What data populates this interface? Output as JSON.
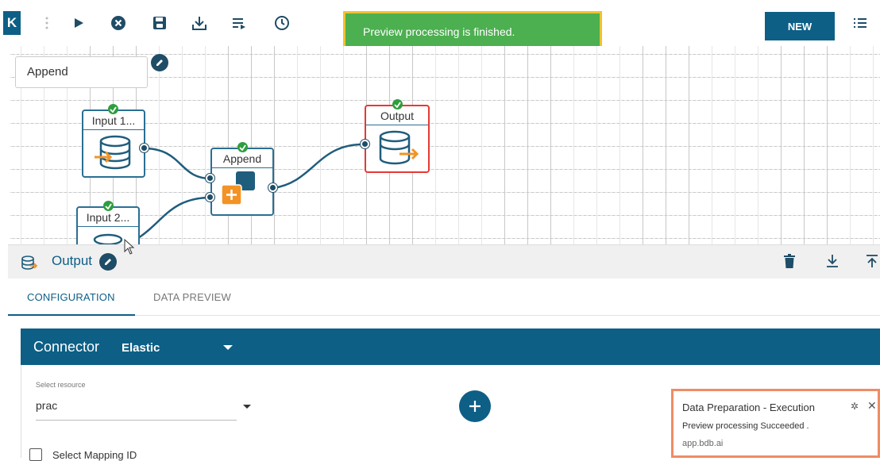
{
  "toolbar": {
    "logo": "K",
    "toast": "Preview processing is finished.",
    "new_label": "NEW",
    "icons": [
      "play-icon",
      "stop-icon",
      "save-icon",
      "download-icon",
      "list-run-icon",
      "history-icon",
      "menu-list-icon"
    ]
  },
  "canvas": {
    "name_value": "Append",
    "nodes": {
      "input1": "Input 1...",
      "input2": "Input 2...",
      "append": "Append",
      "output": "Output"
    }
  },
  "panel": {
    "title": "Output",
    "actions": [
      "trash-icon",
      "download-icon",
      "upload-icon"
    ]
  },
  "tabs": {
    "configuration": "CONFIGURATION",
    "data_preview": "DATA PREVIEW"
  },
  "connector": {
    "label": "Connector",
    "value": "Elastic",
    "resource_label": "Select resource",
    "resource_value": "prac",
    "mapping_label": "Select Mapping ID"
  },
  "notification": {
    "title": "Data Preparation - Execution",
    "message": "Preview processing Succeeded .",
    "source": "app.bdb.ai"
  },
  "colors": {
    "primary": "#0d5f86",
    "toast": "#4caf50",
    "toast_border": "#f2c22c",
    "success": "#2e9e3e",
    "error_border": "#e53935",
    "accent_orange": "#f39325",
    "notif_border": "#f08c64"
  }
}
